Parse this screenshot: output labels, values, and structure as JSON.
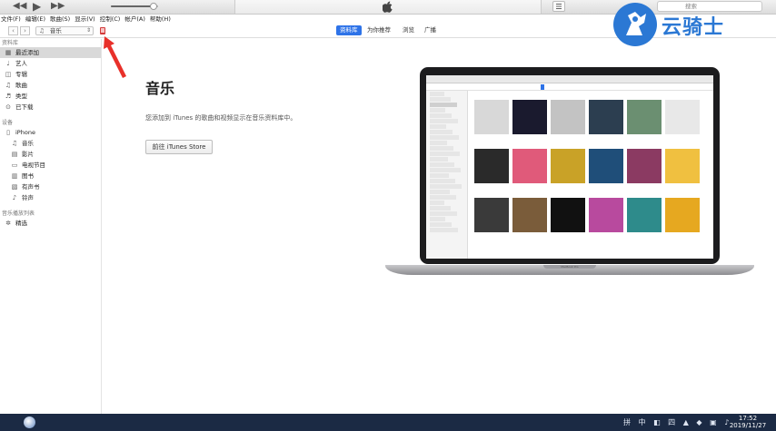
{
  "player": {
    "prev_icon": "rewind-icon",
    "play_icon": "play-icon",
    "next_icon": "fast-forward-icon",
    "volume_level": 0.9
  },
  "menubar": {
    "items": [
      "文件(F)",
      "编辑(E)",
      "歌曲(S)",
      "显示(V)",
      "控制(C)",
      "帐户(A)",
      "帮助(H)"
    ]
  },
  "search": {
    "placeholder": "搜索"
  },
  "nav": {
    "back": "‹",
    "forward": "›",
    "media_type": "音乐",
    "tabs": [
      "资料库",
      "为你推荐",
      "浏览",
      "广播"
    ],
    "active_tab": "资料库"
  },
  "sidebar": {
    "library_header": "资料库",
    "library_items": [
      {
        "label": "最近添加",
        "icon": "grid-icon",
        "glyph": "▦"
      },
      {
        "label": "艺人",
        "icon": "microphone-icon",
        "glyph": "♩"
      },
      {
        "label": "专辑",
        "icon": "album-icon",
        "glyph": "◫"
      },
      {
        "label": "歌曲",
        "icon": "note-icon",
        "glyph": "♫"
      },
      {
        "label": "类型",
        "icon": "genre-icon",
        "glyph": "♬"
      },
      {
        "label": "已下载",
        "icon": "download-icon",
        "glyph": "⊙"
      }
    ],
    "devices_header": "设备",
    "device_name": "iPhone",
    "device_items": [
      {
        "label": "音乐",
        "icon": "note-icon",
        "glyph": "♫"
      },
      {
        "label": "影片",
        "icon": "film-icon",
        "glyph": "▤"
      },
      {
        "label": "电视节目",
        "icon": "tv-icon",
        "glyph": "▭"
      },
      {
        "label": "图书",
        "icon": "book-icon",
        "glyph": "▥"
      },
      {
        "label": "有声书",
        "icon": "audiobook-icon",
        "glyph": "▧"
      },
      {
        "label": "铃声",
        "icon": "bell-icon",
        "glyph": "♪"
      }
    ],
    "playlists_header": "音乐播放列表",
    "playlist_items": [
      {
        "label": "精选",
        "icon": "gear-icon",
        "glyph": "✲"
      }
    ]
  },
  "main": {
    "title": "音乐",
    "description": "您添加到 iTunes 的歌曲和视频显示在音乐资料库中。",
    "store_button": "前往 iTunes Store"
  },
  "laptop": {
    "label": "MacBook Pro",
    "album_colors": [
      "#d8d8d8",
      "#1a1a2e",
      "#c3c3c3",
      "#2c3e50",
      "#6b8f71",
      "#e8e8e8",
      "#2a2a2a",
      "#e05a7a",
      "#c9a227",
      "#1f4e79",
      "#8b3a62",
      "#f0c040",
      "#3a3a3a",
      "#7a5c3a",
      "#111111",
      "#b84a9e",
      "#2e8b8b",
      "#e6a820"
    ]
  },
  "watermark": {
    "text": "云骑士"
  },
  "taskbar": {
    "time": "17:52",
    "date": "2019/11/27",
    "tray": "拼 中 ◧ 四 ▲ ◆ ▣ ♪"
  }
}
